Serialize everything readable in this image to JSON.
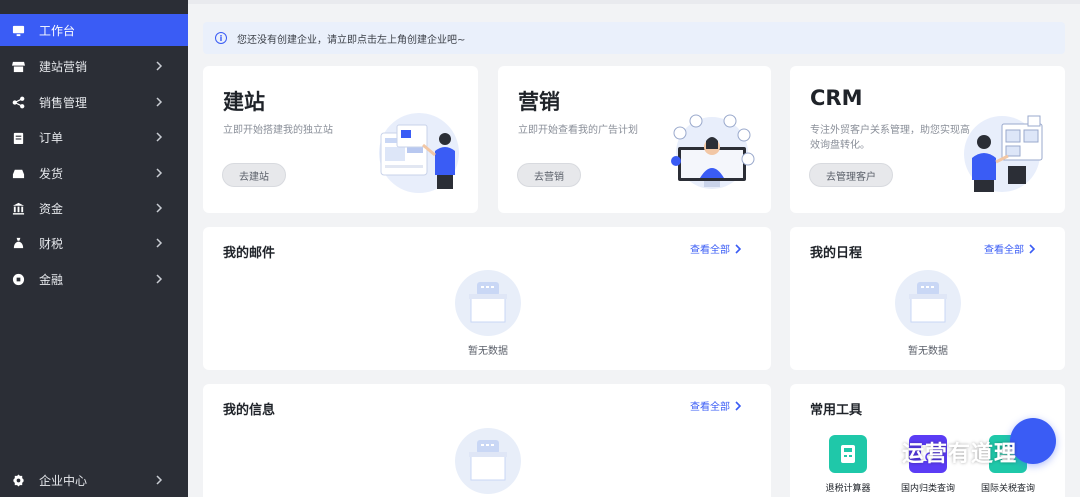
{
  "sidebar": {
    "items": [
      {
        "label": "工作台",
        "icon": "monitor-icon",
        "active": true,
        "chevron": false
      },
      {
        "label": "建站营销",
        "icon": "store-icon",
        "chevron": true
      },
      {
        "label": "销售管理",
        "icon": "share-icon",
        "chevron": true
      },
      {
        "label": "订单",
        "icon": "clipboard-icon",
        "chevron": true
      },
      {
        "label": "发货",
        "icon": "truck-icon",
        "chevron": true
      },
      {
        "label": "资金",
        "icon": "bank-icon",
        "chevron": true
      },
      {
        "label": "财税",
        "icon": "money-bag-icon",
        "chevron": true
      },
      {
        "label": "金融",
        "icon": "coin-icon",
        "chevron": true
      }
    ],
    "bottom": {
      "label": "企业中心",
      "icon": "gear-icon",
      "chevron": true
    }
  },
  "notice": {
    "text": "您还没有创建企业，请立即点击左上角创建企业吧~",
    "icon": "info-icon"
  },
  "cards": {
    "site": {
      "title": "建站",
      "desc": "立即开始搭建我的独立站",
      "button": "去建站"
    },
    "marketing": {
      "title": "营销",
      "desc": "立即开始查看我的广告计划",
      "button": "去营销"
    },
    "crm": {
      "title": "CRM",
      "desc": "专注外贸客户关系管理，助您实现高效询盘转化。",
      "button": "去管理客户"
    }
  },
  "mail": {
    "title": "我的邮件",
    "view_all": "查看全部",
    "empty": "暂无数据"
  },
  "schedule": {
    "title": "我的日程",
    "view_all": "查看全部",
    "empty": "暂无数据"
  },
  "info": {
    "title": "我的信息",
    "view_all": "查看全部"
  },
  "tools": {
    "title": "常用工具",
    "items": [
      {
        "label": "退税计算器",
        "color": "#1fc8a9",
        "icon": "calculator-icon"
      },
      {
        "label": "国内归类查询",
        "color": "#5b3cf5",
        "icon": "search-doc-icon"
      },
      {
        "label": "国际关税查询",
        "color": "#1fc8a9",
        "icon": "globe-icon"
      }
    ]
  },
  "watermark": {
    "text": "运营有道理"
  },
  "colors": {
    "accent": "#3a5cf5",
    "sidebar_bg": "#2b2e36",
    "teal": "#1fc8a9",
    "purple": "#5b3cf5"
  }
}
